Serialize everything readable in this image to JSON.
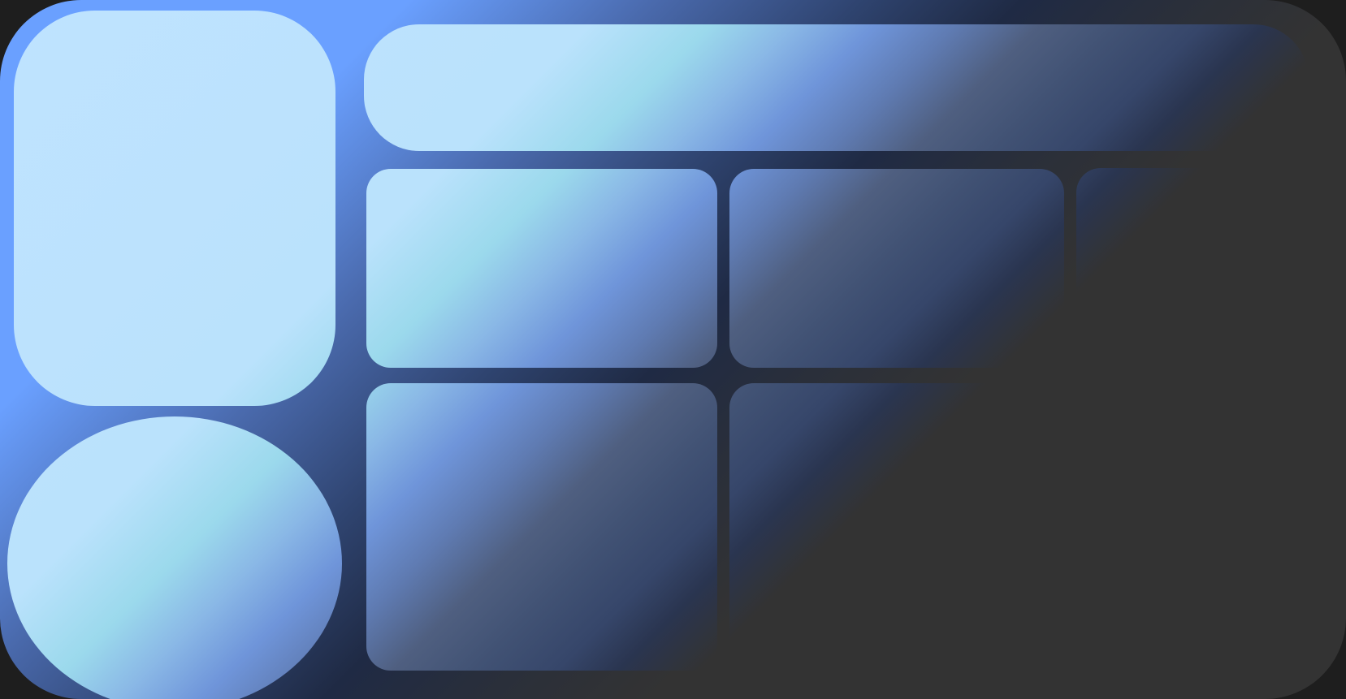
{
  "screen": {
    "title": "",
    "colors": {
      "page_background": "#1e1e1e",
      "frame_gradient": [
        "#6aa0ff",
        "#4a6aad",
        "#2f4470",
        "#1f2a44",
        "#333333"
      ],
      "tile_gradient": [
        "#bfe3ff",
        "#9bd9ec",
        "#6f95da",
        "#4f5f80",
        "#36466a",
        "#333333"
      ]
    }
  },
  "tiles": [
    {
      "id": "tile-1",
      "shape": "rounded-rectangle",
      "label": ""
    },
    {
      "id": "tile-2",
      "shape": "rounded-rectangle",
      "label": ""
    },
    {
      "id": "tile-3",
      "shape": "rounded-rectangle",
      "label": ""
    },
    {
      "id": "tile-4",
      "shape": "rounded-rectangle",
      "label": ""
    },
    {
      "id": "tile-5",
      "shape": "rounded-rectangle",
      "label": ""
    },
    {
      "id": "tile-6",
      "shape": "rounded-rectangle",
      "label": ""
    },
    {
      "id": "tile-7",
      "shape": "rounded-rectangle",
      "label": ""
    },
    {
      "id": "tile-8",
      "shape": "ellipse",
      "label": ""
    }
  ]
}
